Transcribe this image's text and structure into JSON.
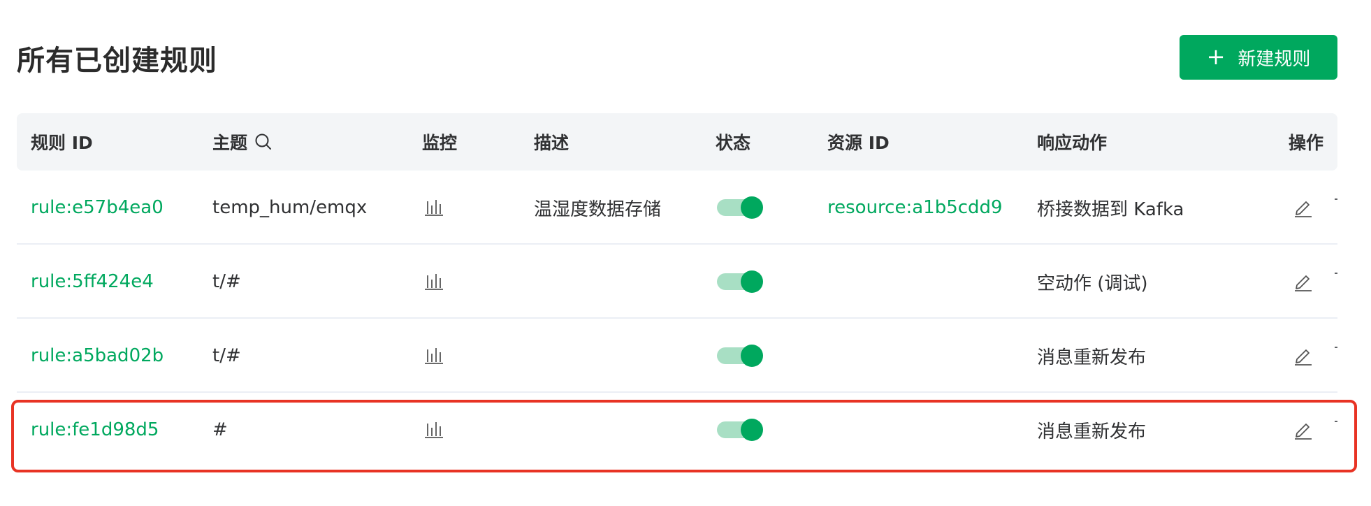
{
  "header": {
    "title": "所有已创建规则",
    "new_button": {
      "icon": "plus-icon",
      "label": "新建规则"
    }
  },
  "table": {
    "columns": [
      {
        "key": "rule_id",
        "label": "规则 ID"
      },
      {
        "key": "topic",
        "label": "主题",
        "icon": "search-icon"
      },
      {
        "key": "monitor",
        "label": "监控"
      },
      {
        "key": "description",
        "label": "描述"
      },
      {
        "key": "status",
        "label": "状态"
      },
      {
        "key": "resource_id",
        "label": "资源 ID"
      },
      {
        "key": "action",
        "label": "响应动作"
      },
      {
        "key": "operation",
        "label": "操作"
      }
    ],
    "rows": [
      {
        "rule_id": "rule:e57b4ea0",
        "topic": "temp_hum/emqx",
        "description": "温湿度数据存储",
        "enabled": true,
        "resource_id": "resource:a1b5cdd9",
        "action": "桥接数据到 Kafka"
      },
      {
        "rule_id": "rule:5ff424e4",
        "topic": "t/#",
        "description": "",
        "enabled": true,
        "resource_id": "",
        "action": "空动作 (调试)"
      },
      {
        "rule_id": "rule:a5bad02b",
        "topic": "t/#",
        "description": "",
        "enabled": true,
        "resource_id": "",
        "action": "消息重新发布"
      },
      {
        "rule_id": "rule:fe1d98d5",
        "topic": "#",
        "description": "",
        "enabled": true,
        "resource_id": "",
        "action": "消息重新发布"
      }
    ],
    "highlighted_row": 3
  },
  "colors": {
    "accent": "#00a85e",
    "switch_track": "#a8dfc4",
    "header_bg": "#f3f5f7",
    "highlight_border": "#e83324"
  }
}
